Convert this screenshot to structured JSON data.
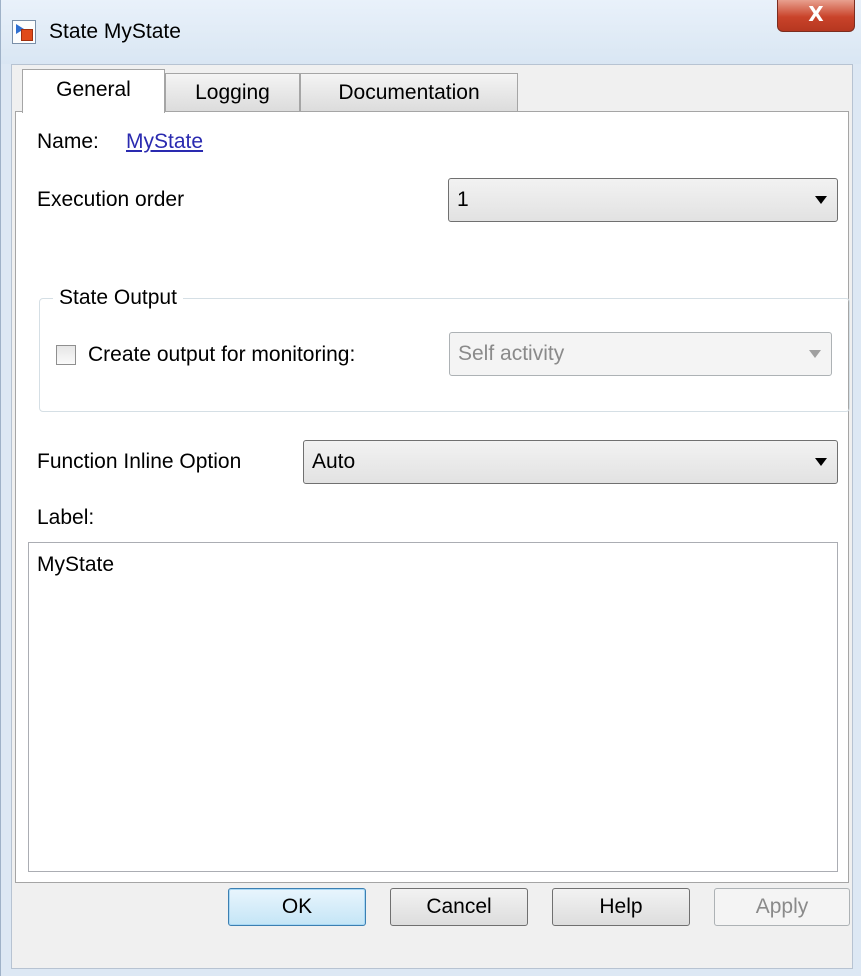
{
  "window": {
    "title": "State MyState",
    "close_glyph": "X"
  },
  "tabs": [
    {
      "label": "General",
      "active": true
    },
    {
      "label": "Logging",
      "active": false
    },
    {
      "label": "Documentation",
      "active": false
    }
  ],
  "general": {
    "name_label": "Name:",
    "name_value": "MyState",
    "execution_order_label": "Execution order",
    "execution_order_value": "1",
    "state_output": {
      "group_title": "State Output",
      "checkbox_label": "Create output for monitoring:",
      "checked": false,
      "monitor_value": "Self activity"
    },
    "function_inline_label": "Function Inline Option",
    "function_inline_value": "Auto",
    "label_heading": "Label:",
    "label_text": "MyState"
  },
  "buttons": {
    "ok": "OK",
    "cancel": "Cancel",
    "help": "Help",
    "apply": "Apply"
  },
  "icons": {
    "app": "stateflow-state-icon",
    "close": "close-icon",
    "dropdown": "chevron-down-icon"
  }
}
